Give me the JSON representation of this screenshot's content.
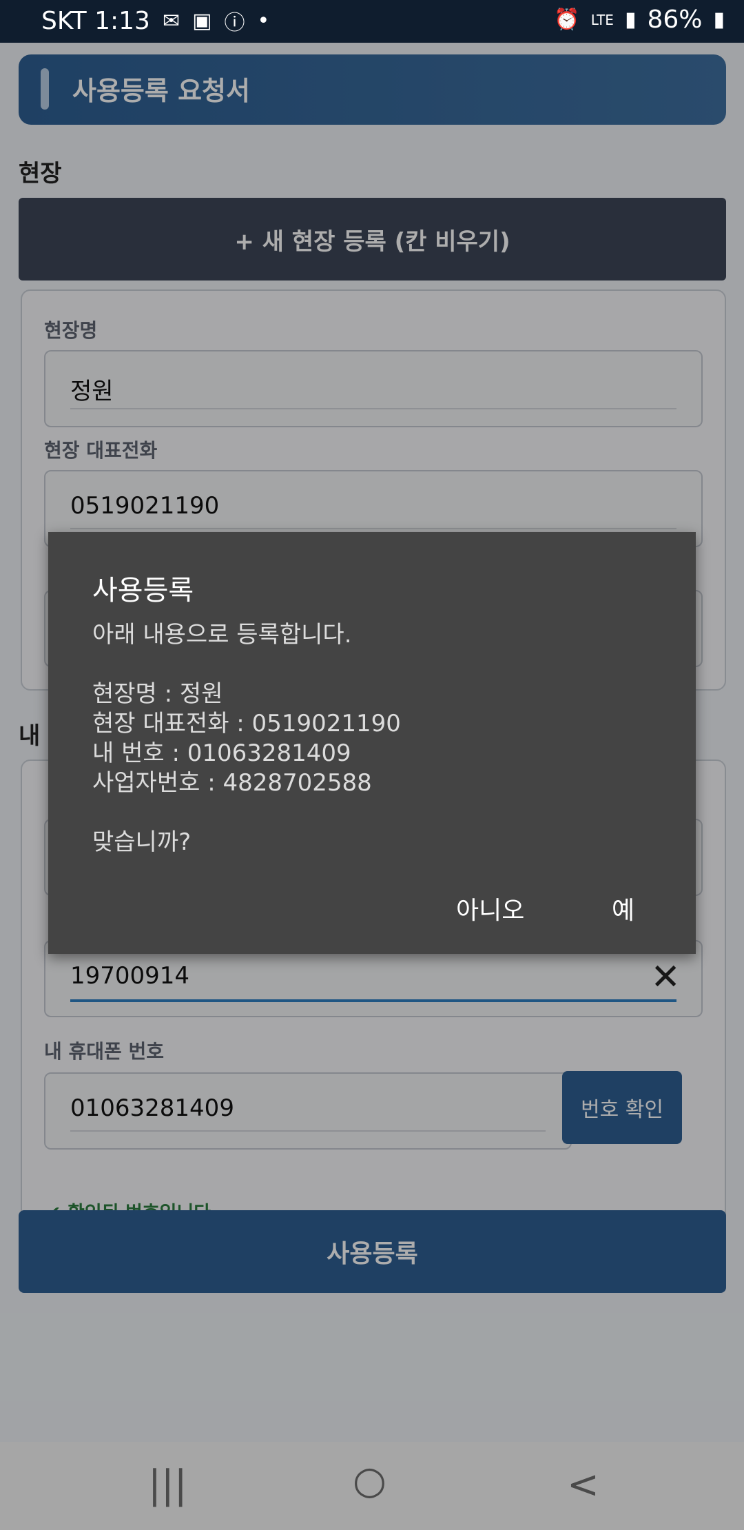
{
  "status_bar": {
    "carrier_time": "SKT 1:13",
    "network": "LTE",
    "battery": "86%"
  },
  "header": {
    "title": "사용등록 요청서"
  },
  "site_section": {
    "label": "현장",
    "new_site_button": "+ 새 현장 등록 (칸 비우기)",
    "site_name_label": "현장명",
    "site_name_value": "정원",
    "site_phone_label": "현장 대표전화",
    "site_phone_value": "0519021190"
  },
  "my_section": {
    "label": "내",
    "birth_value": "19700914",
    "phone_label": "내 휴대폰 번호",
    "phone_value": "01063281409",
    "verify_button": "번호 확인",
    "verified_text": "확인된 번호입니다."
  },
  "submit_button": "사용등록",
  "dialog": {
    "title": "사용등록",
    "message": "아래 내용으로 등록합니다.\n\n현장명 : 정원\n현장 대표전화 : 0519021190\n내 번호 : 01063281409\n사업자번호 : 4828702588\n\n맞습니까?",
    "no_label": "아니오",
    "yes_label": "예"
  },
  "nav": {
    "recent": "|||",
    "home": "○",
    "back": "<"
  }
}
